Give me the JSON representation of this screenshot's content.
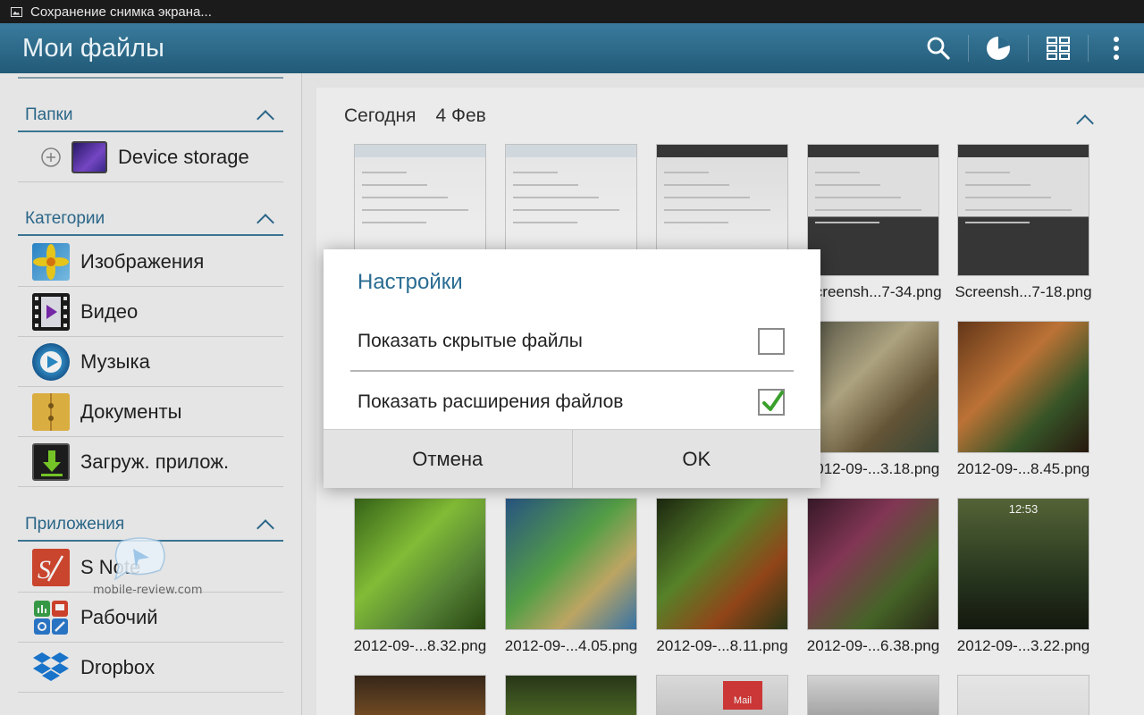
{
  "status_bar": {
    "notification": "Сохранение снимка экрана..."
  },
  "action_bar": {
    "title": "Мои файлы",
    "icons": [
      "search-icon",
      "storage-chart-icon",
      "grid-view-icon",
      "overflow-menu-icon"
    ]
  },
  "sidebar": {
    "folders_header": "Папки",
    "folders": [
      {
        "label": "Device storage",
        "icon": "device-storage-icon"
      }
    ],
    "categories_header": "Категории",
    "categories": [
      {
        "label": "Изображения",
        "icon": "images-icon"
      },
      {
        "label": "Видео",
        "icon": "video-icon"
      },
      {
        "label": "Музыка",
        "icon": "music-icon"
      },
      {
        "label": "Документы",
        "icon": "documents-icon"
      },
      {
        "label": "Загруж. прилож.",
        "icon": "downloads-icon"
      }
    ],
    "apps_header": "Приложения",
    "apps": [
      {
        "label": "S Note",
        "icon": "s-note-icon"
      },
      {
        "label": "Рабочий",
        "icon": "work-icon"
      },
      {
        "label": "Dropbox",
        "icon": "dropbox-icon"
      }
    ]
  },
  "main": {
    "date_label": "Сегодня",
    "date_value": "4 Фев",
    "files": [
      {
        "name": "",
        "thumb": "document"
      },
      {
        "name": "",
        "thumb": "document"
      },
      {
        "name": "",
        "thumb": "app-ui"
      },
      {
        "name": "Screensh...7-34.png",
        "thumb": "keyboard"
      },
      {
        "name": "Screensh...7-18.png",
        "thumb": "keyboard"
      },
      {
        "name": "",
        "thumb": "game"
      },
      {
        "name": "",
        "thumb": "game"
      },
      {
        "name": "",
        "thumb": "game"
      },
      {
        "name": "2012-09-...3.18.png",
        "thumb": "game"
      },
      {
        "name": "2012-09-...8.45.png",
        "thumb": "game"
      },
      {
        "name": "2012-09-...8.32.png",
        "thumb": "game"
      },
      {
        "name": "2012-09-...4.05.png",
        "thumb": "game"
      },
      {
        "name": "2012-09-...8.11.png",
        "thumb": "game"
      },
      {
        "name": "2012-09-...6.38.png",
        "thumb": "game"
      },
      {
        "name": "2012-09-...3.22.png",
        "thumb": "lockscreen"
      }
    ],
    "lock_time": "12:53",
    "mail_label": "Mail"
  },
  "dialog": {
    "title": "Настройки",
    "options": [
      {
        "label": "Показать скрытые файлы",
        "checked": false
      },
      {
        "label": "Показать расширения файлов",
        "checked": true
      }
    ],
    "cancel": "Отмена",
    "ok": "OK"
  },
  "watermark": {
    "text": "mobile-review.com"
  },
  "colors": {
    "accent": "#2d6d91",
    "action_bar": "#2c6a8c",
    "check": "#3aa02c"
  }
}
